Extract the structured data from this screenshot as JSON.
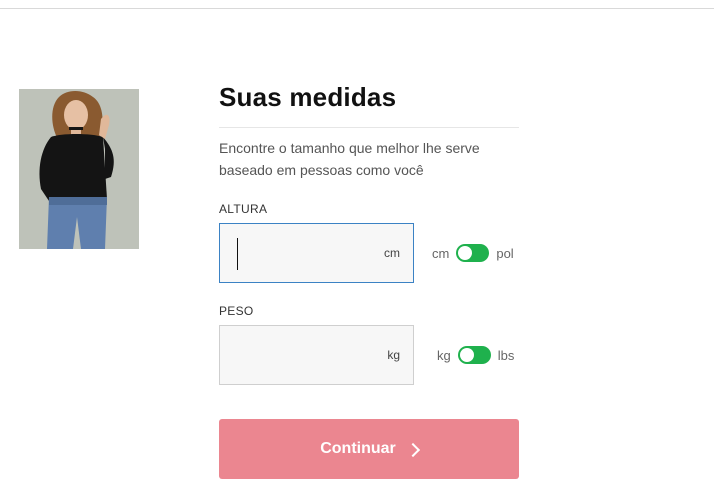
{
  "header": {
    "title": "Suas medidas",
    "subtitle": "Encontre o tamanho que melhor lhe serve baseado em pessoas como você"
  },
  "height_field": {
    "label": "ALTURA",
    "value": "",
    "unit_suffix": "cm",
    "toggle_left": "cm",
    "toggle_right": "pol"
  },
  "weight_field": {
    "label": "PESO",
    "value": "",
    "unit_suffix": "kg",
    "toggle_left": "kg",
    "toggle_right": "lbs"
  },
  "actions": {
    "continue_label": "Continuar"
  },
  "icons": {
    "continue_chevron": "chevron-right-icon"
  },
  "colors": {
    "accent_button": "#eb8690",
    "toggle_on": "#1fb14d",
    "focus_border": "#3b82c4"
  }
}
